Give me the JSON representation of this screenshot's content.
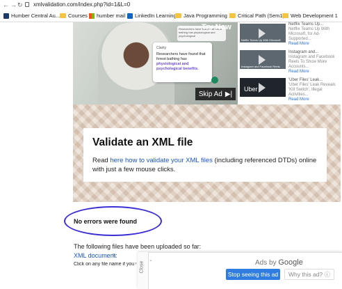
{
  "browser": {
    "url": "xmlvalidation.com/index.php?id=1&L=0",
    "nav": {
      "back": "←",
      "forward": "→",
      "reload": "↻"
    },
    "bookmarks": [
      {
        "label": "Humber Central Au...",
        "icon": "humber-icon"
      },
      {
        "label": "Courses",
        "icon": "folder-icon"
      },
      {
        "label": "humber mail",
        "icon": "microsoft-icon"
      },
      {
        "label": "LinkedIn Learning",
        "icon": "linkedin-icon"
      },
      {
        "label": "Java Programming 1",
        "icon": "folder-icon"
      },
      {
        "label": "Critical Path (Sem1)",
        "icon": "folder-icon"
      },
      {
        "label": "Web Development 1",
        "icon": "folder-icon"
      }
    ]
  },
  "video_ad": {
    "try_now": "Try Now",
    "card_brand": "Clarity",
    "card_text": "Researchers have found that forest bathing has",
    "card_highlight": "physiological and psychological benefits.",
    "mini_card_text": "Researchers have found that forest bathing has physiological and psychological",
    "skip_label": "Skip Ad",
    "skip_icon": "▶|"
  },
  "related": [
    {
      "title": "Netflix Teams Up...",
      "desc": "Netflix Teams Up With Microsoft, for Ad-Supported...",
      "more": "Read More",
      "caption": "Netflix Teams Up With Microsoft"
    },
    {
      "title": "Instagram and...",
      "desc": "Instagram and Facebook Reels To Show More Accounts...",
      "more": "Read More",
      "caption": "Instagram and Facebook Reels"
    },
    {
      "title": "'Uber Files' Leak...",
      "desc": "'Uber Files' Leak Reveals 'Kill Switch', Illegal Activities...",
      "more": "Read More",
      "caption": "Uber"
    }
  ],
  "main": {
    "heading": "Validate an XML file",
    "intro_pre": "Read ",
    "intro_link": "here how to validate your XML files",
    "intro_post": " (including referenced DTDs) online with just a few mouse clicks.",
    "no_errors": "No errors were found",
    "uploaded_text": "The following files have been uploaded so far:",
    "xml_doc_link": "XML document:",
    "click_any": "Click on any file name if you w"
  },
  "bottom_ad": {
    "close": "Close",
    "ads_by": "Ads by",
    "google": "Google",
    "stop_label": "Stop seeing this ad",
    "why_label": "Why this ad? ⓘ"
  }
}
